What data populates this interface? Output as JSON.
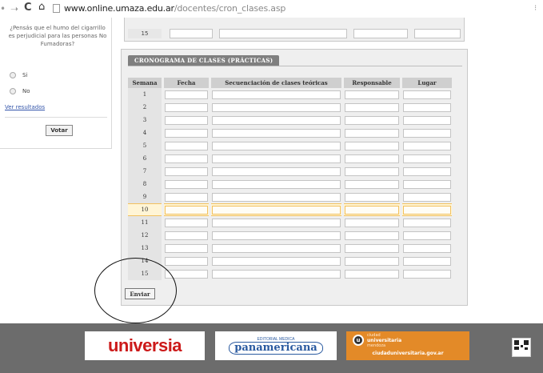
{
  "browser": {
    "url_host": "www.online.umaza.edu.ar",
    "url_path": "/docentes/cron_clases.asp"
  },
  "poll": {
    "question": "¿Pensás que el humo del cigarrillo es perjudicial para las personas No Fumadoras?",
    "options": [
      "Si",
      "No"
    ],
    "results_link": "Ver resultados",
    "vote_button": "Votar"
  },
  "top_table": {
    "last_row": "15"
  },
  "schedule": {
    "title": "CRONOGRAMA DE CLASES (PRÁCTICAS)",
    "columns": [
      "Semana",
      "Fecha",
      "Secuenciación de clases teóricas",
      "Responsable",
      "Lugar"
    ],
    "rows": [
      "1",
      "2",
      "3",
      "4",
      "5",
      "6",
      "7",
      "8",
      "9",
      "10",
      "11",
      "12",
      "13",
      "14",
      "15"
    ],
    "highlighted_row": "10",
    "submit_button": "Enviar"
  },
  "footer": {
    "sponsors": [
      {
        "name": "universia"
      },
      {
        "publisher_tag": "EDITORIAL MEDICA",
        "name": "panamericana"
      },
      {
        "tag": "ciudad",
        "name": "universitaria",
        "sub": "mendoza",
        "domain": "ciudaduniversitaria.gov.ar"
      }
    ]
  },
  "colors": {
    "panel_bg": "#efefef",
    "header_tab": "#7f7f7f",
    "highlight_row": "#fff5d6",
    "highlight_border": "#f2c15f",
    "footer_bg": "#6c6c6c",
    "universia_red": "#cc1a1a",
    "panamericana_blue": "#2a5aa0",
    "ciudad_orange": "#e38a28"
  },
  "icons": [
    "back-arrow-icon",
    "forward-arrow-icon",
    "reload-icon",
    "home-icon",
    "page-icon",
    "qr-code-icon"
  ]
}
